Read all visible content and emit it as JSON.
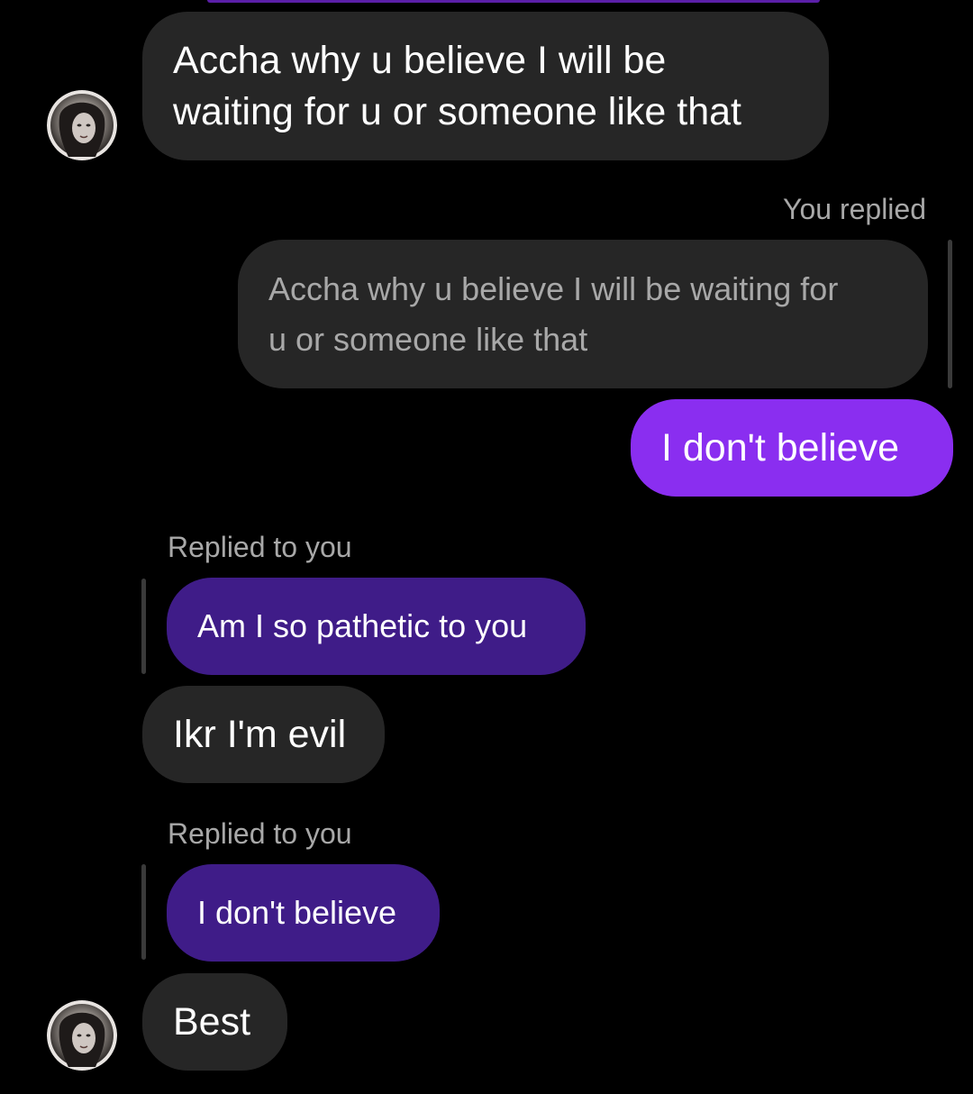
{
  "chat": {
    "messages": [
      {
        "id": "m1",
        "sender": "them",
        "text": "Accha why u believe I will be\nwaiting for u or someone like that"
      },
      {
        "id": "m2",
        "sender": "me",
        "reply_label": "You replied",
        "quoted_text": "Accha why u believe I will be waiting for\nu or someone like that",
        "text": "I don't believe"
      },
      {
        "id": "m3",
        "sender": "them",
        "reply_label": "Replied to you",
        "quoted_text": "Am I so pathetic to you",
        "text": "Ikr I'm evil"
      },
      {
        "id": "m4",
        "sender": "them",
        "reply_label": "Replied to you",
        "quoted_text": "I don't believe",
        "text": "Best"
      }
    ]
  },
  "colors": {
    "background": "#000000",
    "incoming_bubble": "#262626",
    "outgoing_bubble": "#8a2ef0",
    "quoted_my_message": "#3f1c88",
    "secondary_text": "#a8a8a8"
  },
  "icons": {
    "avatar": "contact-avatar-icon"
  }
}
